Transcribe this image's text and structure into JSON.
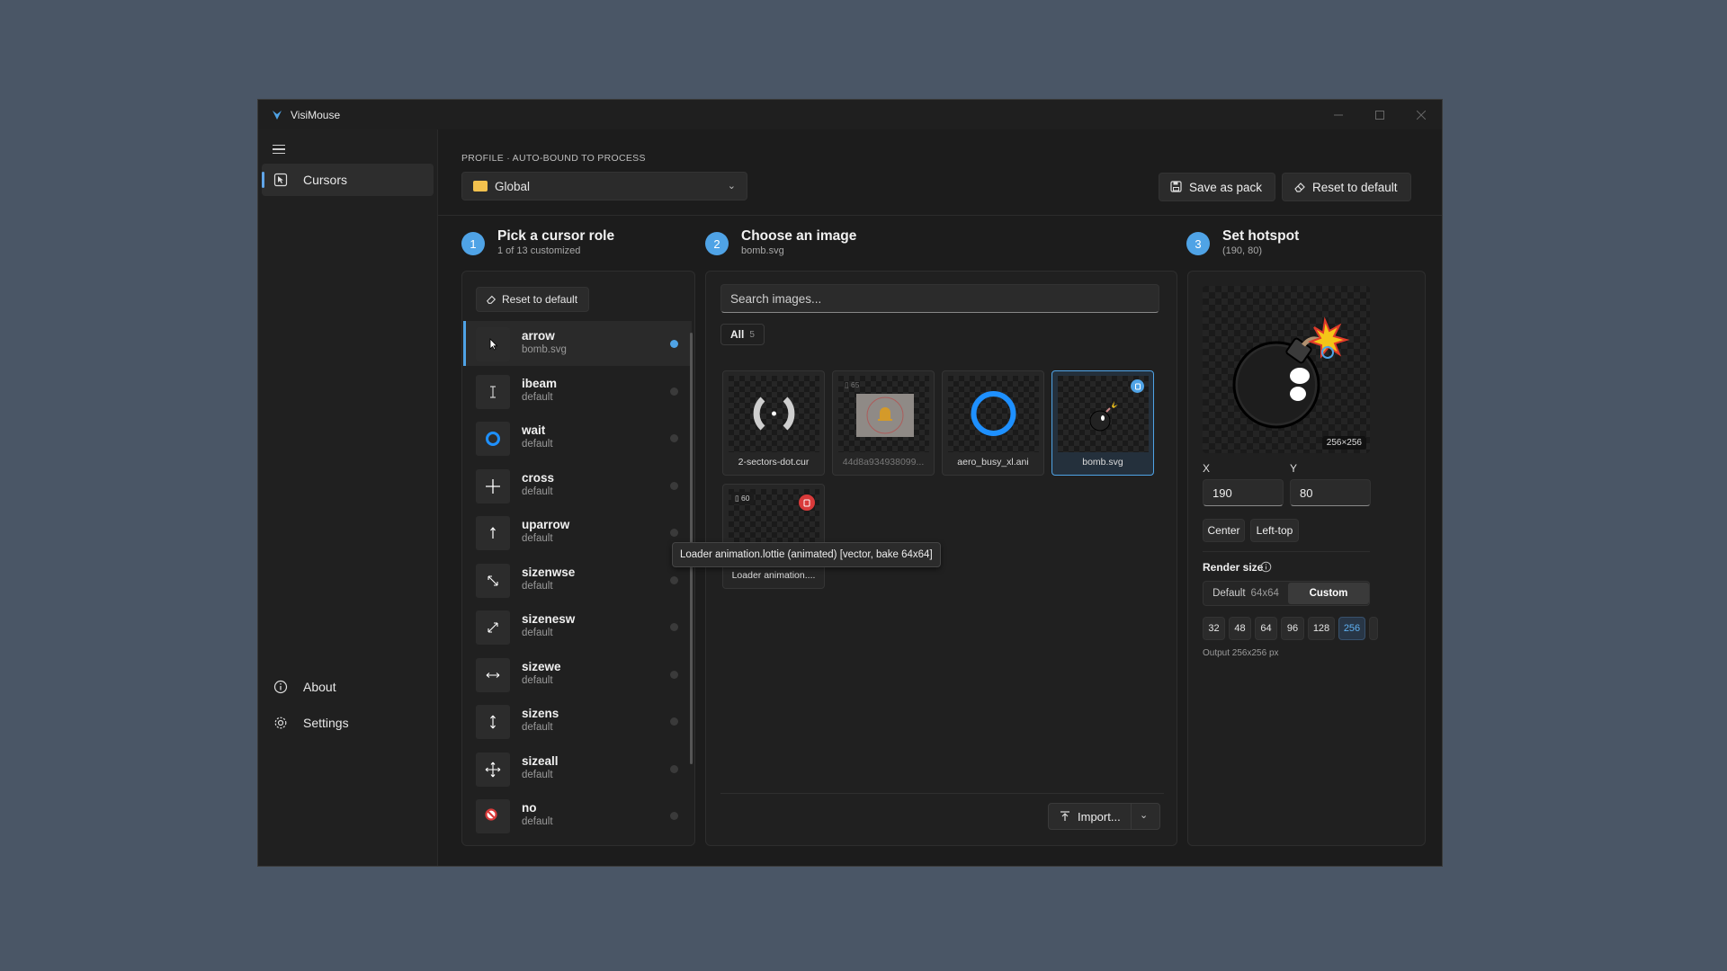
{
  "app": {
    "title": "VisiMouse"
  },
  "nav": {
    "cursors_label": "Cursors",
    "about_label": "About",
    "settings_label": "Settings"
  },
  "profile": {
    "caption": "PROFILE · AUTO-BOUND TO PROCESS",
    "selected": "Global",
    "save_pack_label": "Save as pack",
    "reset_label": "Reset to default"
  },
  "steps": {
    "role": {
      "num": "1",
      "title": "Pick a cursor role",
      "subtitle": "1 of 13 customized"
    },
    "image": {
      "num": "2",
      "title": "Choose an image",
      "subtitle": "bomb.svg"
    },
    "hotspot": {
      "num": "3",
      "title": "Set hotspot",
      "subtitle": "(190, 80)"
    }
  },
  "roles": {
    "reset_label": "Reset to default",
    "items": [
      {
        "name": "arrow",
        "source": "bomb.svg",
        "icon": "arrow-cursor-icon"
      },
      {
        "name": "ibeam",
        "source": "default",
        "icon": "ibeam-cursor-icon"
      },
      {
        "name": "wait",
        "source": "default",
        "icon": "wait-ring-icon"
      },
      {
        "name": "cross",
        "source": "default",
        "icon": "cross-cursor-icon"
      },
      {
        "name": "uparrow",
        "source": "default",
        "icon": "uparrow-cursor-icon"
      },
      {
        "name": "sizenwse",
        "source": "default",
        "icon": "sizenwse-cursor-icon"
      },
      {
        "name": "sizenesw",
        "source": "default",
        "icon": "sizenesw-cursor-icon"
      },
      {
        "name": "sizewe",
        "source": "default",
        "icon": "sizewe-cursor-icon"
      },
      {
        "name": "sizens",
        "source": "default",
        "icon": "sizens-cursor-icon"
      },
      {
        "name": "sizeall",
        "source": "default",
        "icon": "sizeall-cursor-icon"
      },
      {
        "name": "no",
        "source": "default",
        "icon": "no-cursor-icon"
      }
    ]
  },
  "images": {
    "search_placeholder": "Search images...",
    "filter_label": "All",
    "filter_count": "5",
    "tiles": [
      {
        "label": "2-sectors-dot.cur"
      },
      {
        "label": "44d8a934938099...",
        "badge": "65"
      },
      {
        "label": "aero_busy_xl.ani"
      },
      {
        "label": "bomb.svg"
      },
      {
        "label": "Loader animation....",
        "badge": "60"
      }
    ],
    "tooltip": "Loader animation.lottie  (animated)  [vector, bake 64x64]",
    "import_label": "Import..."
  },
  "hotspot": {
    "preview_size": "256×256",
    "x_label": "X",
    "y_label": "Y",
    "x": "190",
    "y": "80",
    "center_label": "Center",
    "lefttop_label": "Left-top",
    "render_title": "Render size",
    "default_label": "Default",
    "default_size": "64x64",
    "custom_label": "Custom",
    "sizes": [
      "32",
      "48",
      "64",
      "96",
      "128",
      "256"
    ],
    "output": "Output 256x256 px"
  },
  "colors": {
    "accent": "#4fa3e6",
    "danger": "#d93a3a",
    "background": "#4a5666"
  }
}
